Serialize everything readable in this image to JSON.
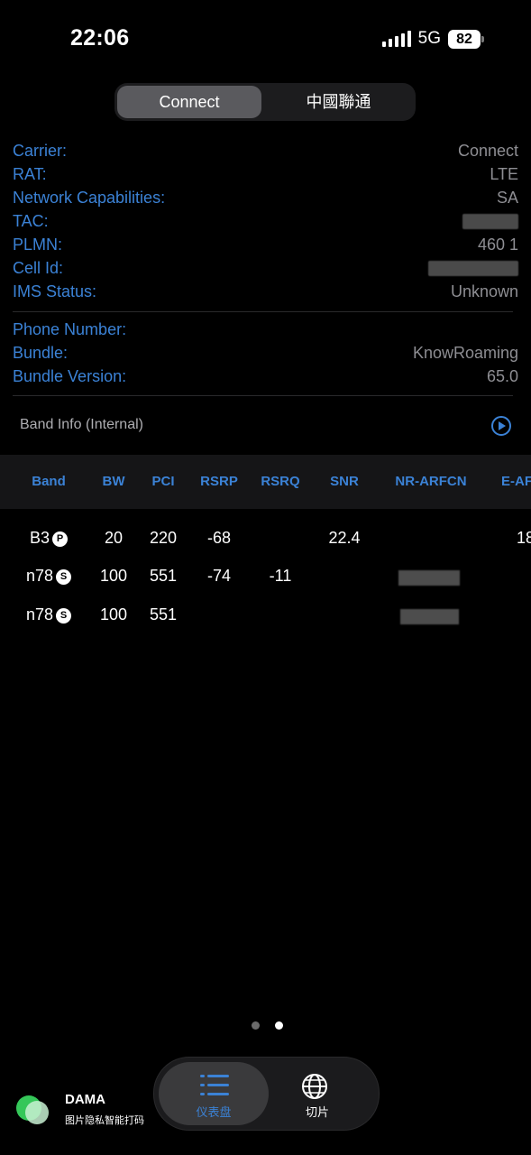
{
  "status_bar": {
    "time": "22:06",
    "network": "5G",
    "battery": "82"
  },
  "segment": {
    "options": [
      "Connect",
      "中國聯通"
    ],
    "selected": "Connect"
  },
  "carrier_info": [
    {
      "label": "Carrier:",
      "value": "Connect"
    },
    {
      "label": "RAT:",
      "value": "LTE"
    },
    {
      "label": "Network Capabilities:",
      "value": "SA"
    },
    {
      "label": "TAC:",
      "value": ""
    },
    {
      "label": "PLMN:",
      "value": "460 1"
    },
    {
      "label": "Cell Id:",
      "value": ""
    },
    {
      "label": "IMS Status:",
      "value": "Unknown"
    }
  ],
  "bundle_info": [
    {
      "label": "Phone Number:",
      "value": ""
    },
    {
      "label": "Bundle:",
      "value": "KnowRoaming"
    },
    {
      "label": "Bundle Version:",
      "value": "65.0"
    }
  ],
  "band_section": {
    "title": "Band Info (Internal)"
  },
  "band_table": {
    "columns": [
      "Band",
      "BW",
      "PCI",
      "RSRP",
      "RSRQ",
      "SNR",
      "NR-ARFCN",
      "E-AF"
    ],
    "rows": [
      {
        "band": "B3",
        "badge": "P",
        "bw": "20",
        "pci": "220",
        "rsrp": "-68",
        "rsrq": "",
        "snr": "22.4",
        "nr_arfcn": "",
        "e_af": "18"
      },
      {
        "band": "n78",
        "badge": "S",
        "bw": "100",
        "pci": "551",
        "rsrp": "-74",
        "rsrq": "-11",
        "snr": "",
        "nr_arfcn": "",
        "e_af": ""
      },
      {
        "band": "n78",
        "badge": "S",
        "bw": "100",
        "pci": "551",
        "rsrp": "",
        "rsrq": "",
        "snr": "",
        "nr_arfcn": "",
        "e_af": ""
      }
    ]
  },
  "page_dots": {
    "count": 2,
    "active": 2
  },
  "tab_bar": {
    "tabs": [
      {
        "label": "仪表盘",
        "icon": "list-icon"
      },
      {
        "label": "切片",
        "icon": "globe-icon"
      }
    ],
    "selected": "仪表盘"
  },
  "watermark": {
    "title": "DAMA",
    "subtitle": "图片隐私智能打码"
  },
  "colors": {
    "accent": "#3b82d6",
    "background": "#000000",
    "value_gray": "#8e8e93"
  }
}
